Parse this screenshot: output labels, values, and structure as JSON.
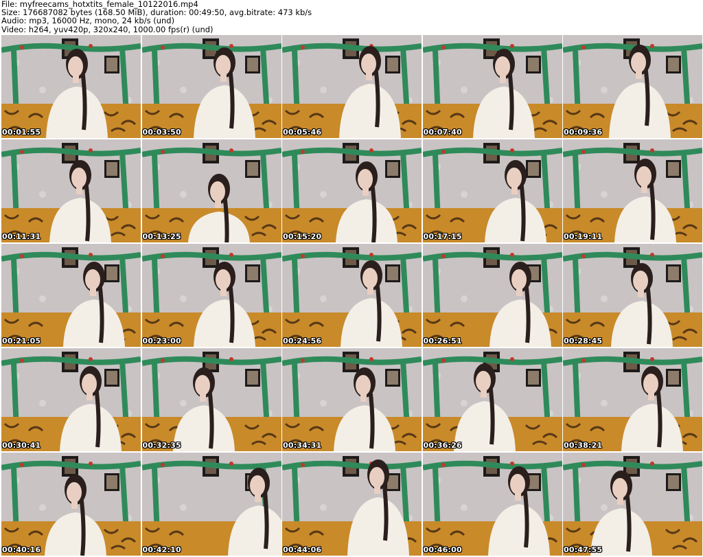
{
  "header": {
    "file": "File: myfreecams_hotxtits_female_10122016.mp4",
    "size": "Size: 176687082 bytes (168.50 MiB), duration: 00:49:50, avg.bitrate: 473 kb/s",
    "audio": "Audio: mp3, 16000 Hz, mono, 24 kb/s (und)",
    "video": "Video: h264, yuv420p, 320x240, 1000.00 fps(r) (und)"
  },
  "thumbnails": [
    "00:01:55",
    "00:03:50",
    "00:05:46",
    "00:07:40",
    "00:09:36",
    "00:11:31",
    "00:13:25",
    "00:15:20",
    "00:17:15",
    "00:19:11",
    "00:21:05",
    "00:23:00",
    "00:24:56",
    "00:26:51",
    "00:28:45",
    "00:30:41",
    "00:32:35",
    "00:34:31",
    "00:36:26",
    "00:38:21",
    "00:40:16",
    "00:42:10",
    "00:44:06",
    "00:46:00",
    "00:47:55"
  ],
  "colors": {
    "wall": "#c9c3c4",
    "garland": "#2f8a5a",
    "sofa": "#c98a2a",
    "sweater": "#f3efe6",
    "hair": "#2a1f1c"
  }
}
